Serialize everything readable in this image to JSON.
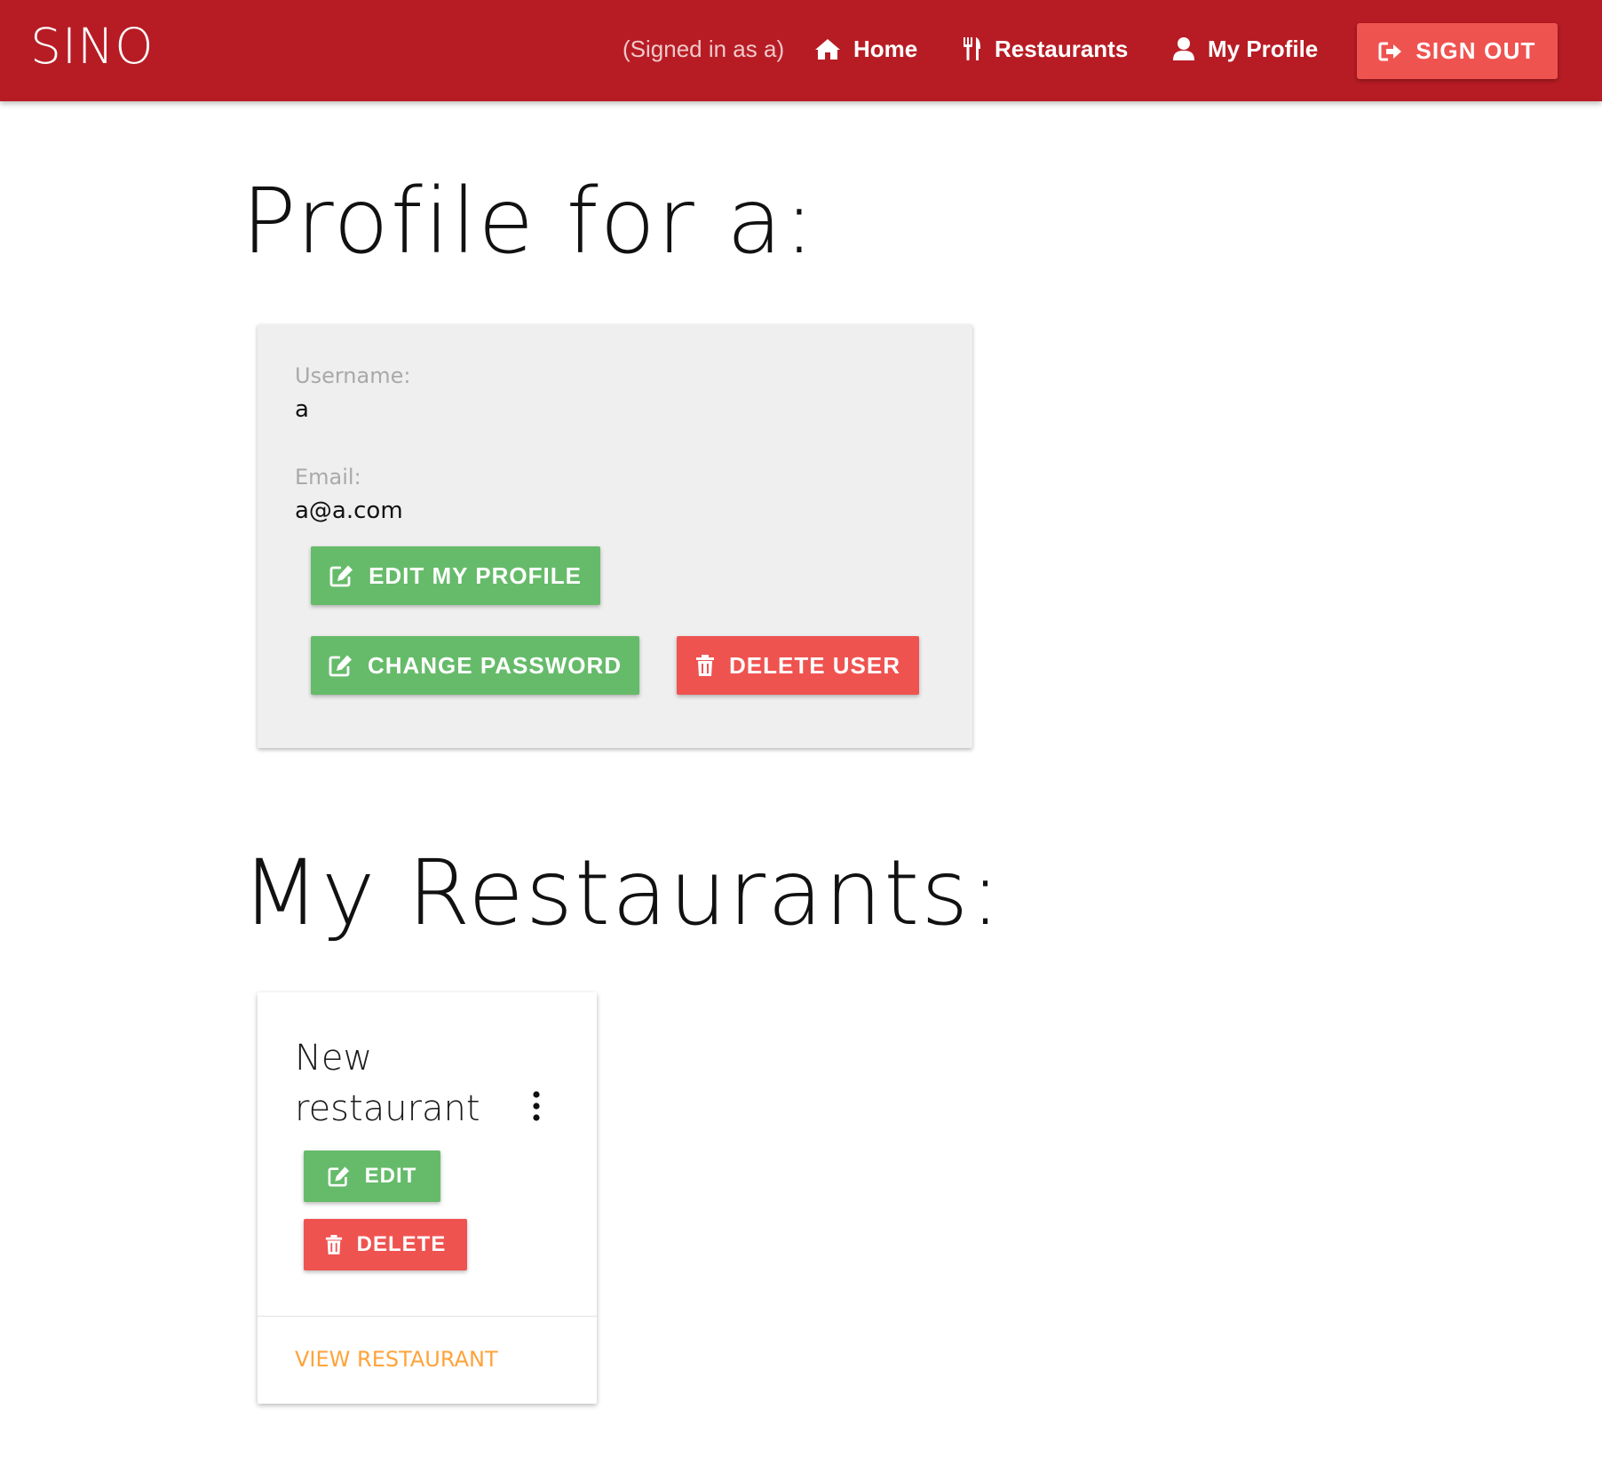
{
  "navbar": {
    "brand": "SINO",
    "signed_in_text": "(Signed in as a)",
    "links": [
      {
        "label": "Home",
        "icon": "home-icon"
      },
      {
        "label": "Restaurants",
        "icon": "utensils-icon"
      },
      {
        "label": "My Profile",
        "icon": "user-icon"
      }
    ],
    "sign_out_label": "SIGN OUT",
    "sign_out_icon": "sign-out-icon"
  },
  "profile": {
    "heading": "Profile for a:",
    "username_label": "Username:",
    "username_value": "a",
    "email_label": "Email:",
    "email_value": "a@a.com",
    "buttons": {
      "edit_profile": "EDIT MY PROFILE",
      "change_password": "CHANGE PASSWORD",
      "delete_user": "DELETE USER"
    }
  },
  "restaurants": {
    "heading": "My Restaurants:",
    "items": [
      {
        "name": "New restaurant",
        "edit_label": "EDIT",
        "delete_label": "DELETE",
        "view_label": "VIEW RESTAURANT"
      }
    ]
  },
  "colors": {
    "navbar": "#b71c24",
    "green": "#66bb6a",
    "red": "#ef5350",
    "orange_link": "#ffa33a",
    "card_grey": "#efefef"
  }
}
